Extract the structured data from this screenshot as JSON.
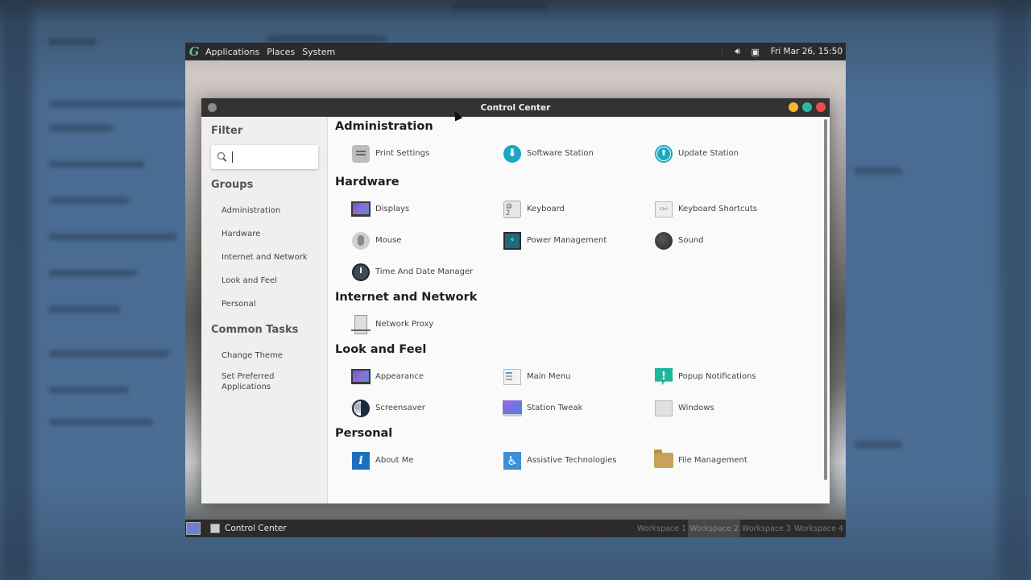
{
  "topbar": {
    "menus": [
      "Applications",
      "Places",
      "System"
    ],
    "clock": "Fri Mar 26, 15:50",
    "tray_icons": [
      "volume-icon",
      "screenshot-icon"
    ]
  },
  "window": {
    "title": "Control Center"
  },
  "sidebar": {
    "filter_heading": "Filter",
    "search_placeholder": "",
    "groups_heading": "Groups",
    "groups": [
      "Administration",
      "Hardware",
      "Internet and Network",
      "Look and Feel",
      "Personal"
    ],
    "tasks_heading": "Common Tasks",
    "tasks": [
      "Change Theme",
      "Set Preferred Applications"
    ]
  },
  "sections": [
    {
      "title": "Administration",
      "items": [
        {
          "label": "Print Settings",
          "icon": "printer-icon"
        },
        {
          "label": "Software Station",
          "icon": "software-station-icon"
        },
        {
          "label": "Update Station",
          "icon": "update-station-icon"
        }
      ]
    },
    {
      "title": "Hardware",
      "items": [
        {
          "label": "Displays",
          "icon": "display-icon"
        },
        {
          "label": "Keyboard",
          "icon": "keyboard-icon"
        },
        {
          "label": "Keyboard Shortcuts",
          "icon": "keyboard-shortcuts-icon"
        },
        {
          "label": "Mouse",
          "icon": "mouse-icon"
        },
        {
          "label": "Power Management",
          "icon": "power-management-icon"
        },
        {
          "label": "Sound",
          "icon": "sound-icon"
        },
        {
          "label": "Time And Date Manager",
          "icon": "clock-icon"
        }
      ]
    },
    {
      "title": "Internet and Network",
      "items": [
        {
          "label": "Network Proxy",
          "icon": "network-proxy-icon"
        }
      ]
    },
    {
      "title": "Look and Feel",
      "items": [
        {
          "label": "Appearance",
          "icon": "appearance-icon"
        },
        {
          "label": "Main Menu",
          "icon": "main-menu-icon"
        },
        {
          "label": "Popup Notifications",
          "icon": "popup-notifications-icon"
        },
        {
          "label": "Screensaver",
          "icon": "screensaver-icon"
        },
        {
          "label": "Station Tweak",
          "icon": "station-tweak-icon"
        },
        {
          "label": "Windows",
          "icon": "windows-icon"
        }
      ]
    },
    {
      "title": "Personal",
      "items": [
        {
          "label": "About Me",
          "icon": "about-me-icon"
        },
        {
          "label": "Assistive Technologies",
          "icon": "accessibility-icon"
        },
        {
          "label": "File Management",
          "icon": "folder-icon"
        }
      ]
    }
  ],
  "taskbar": {
    "task_label": "Control Center",
    "workspaces": [
      "Workspace 1",
      "Workspace 2",
      "Workspace 3",
      "Workspace 4"
    ],
    "active_workspace": 2
  }
}
